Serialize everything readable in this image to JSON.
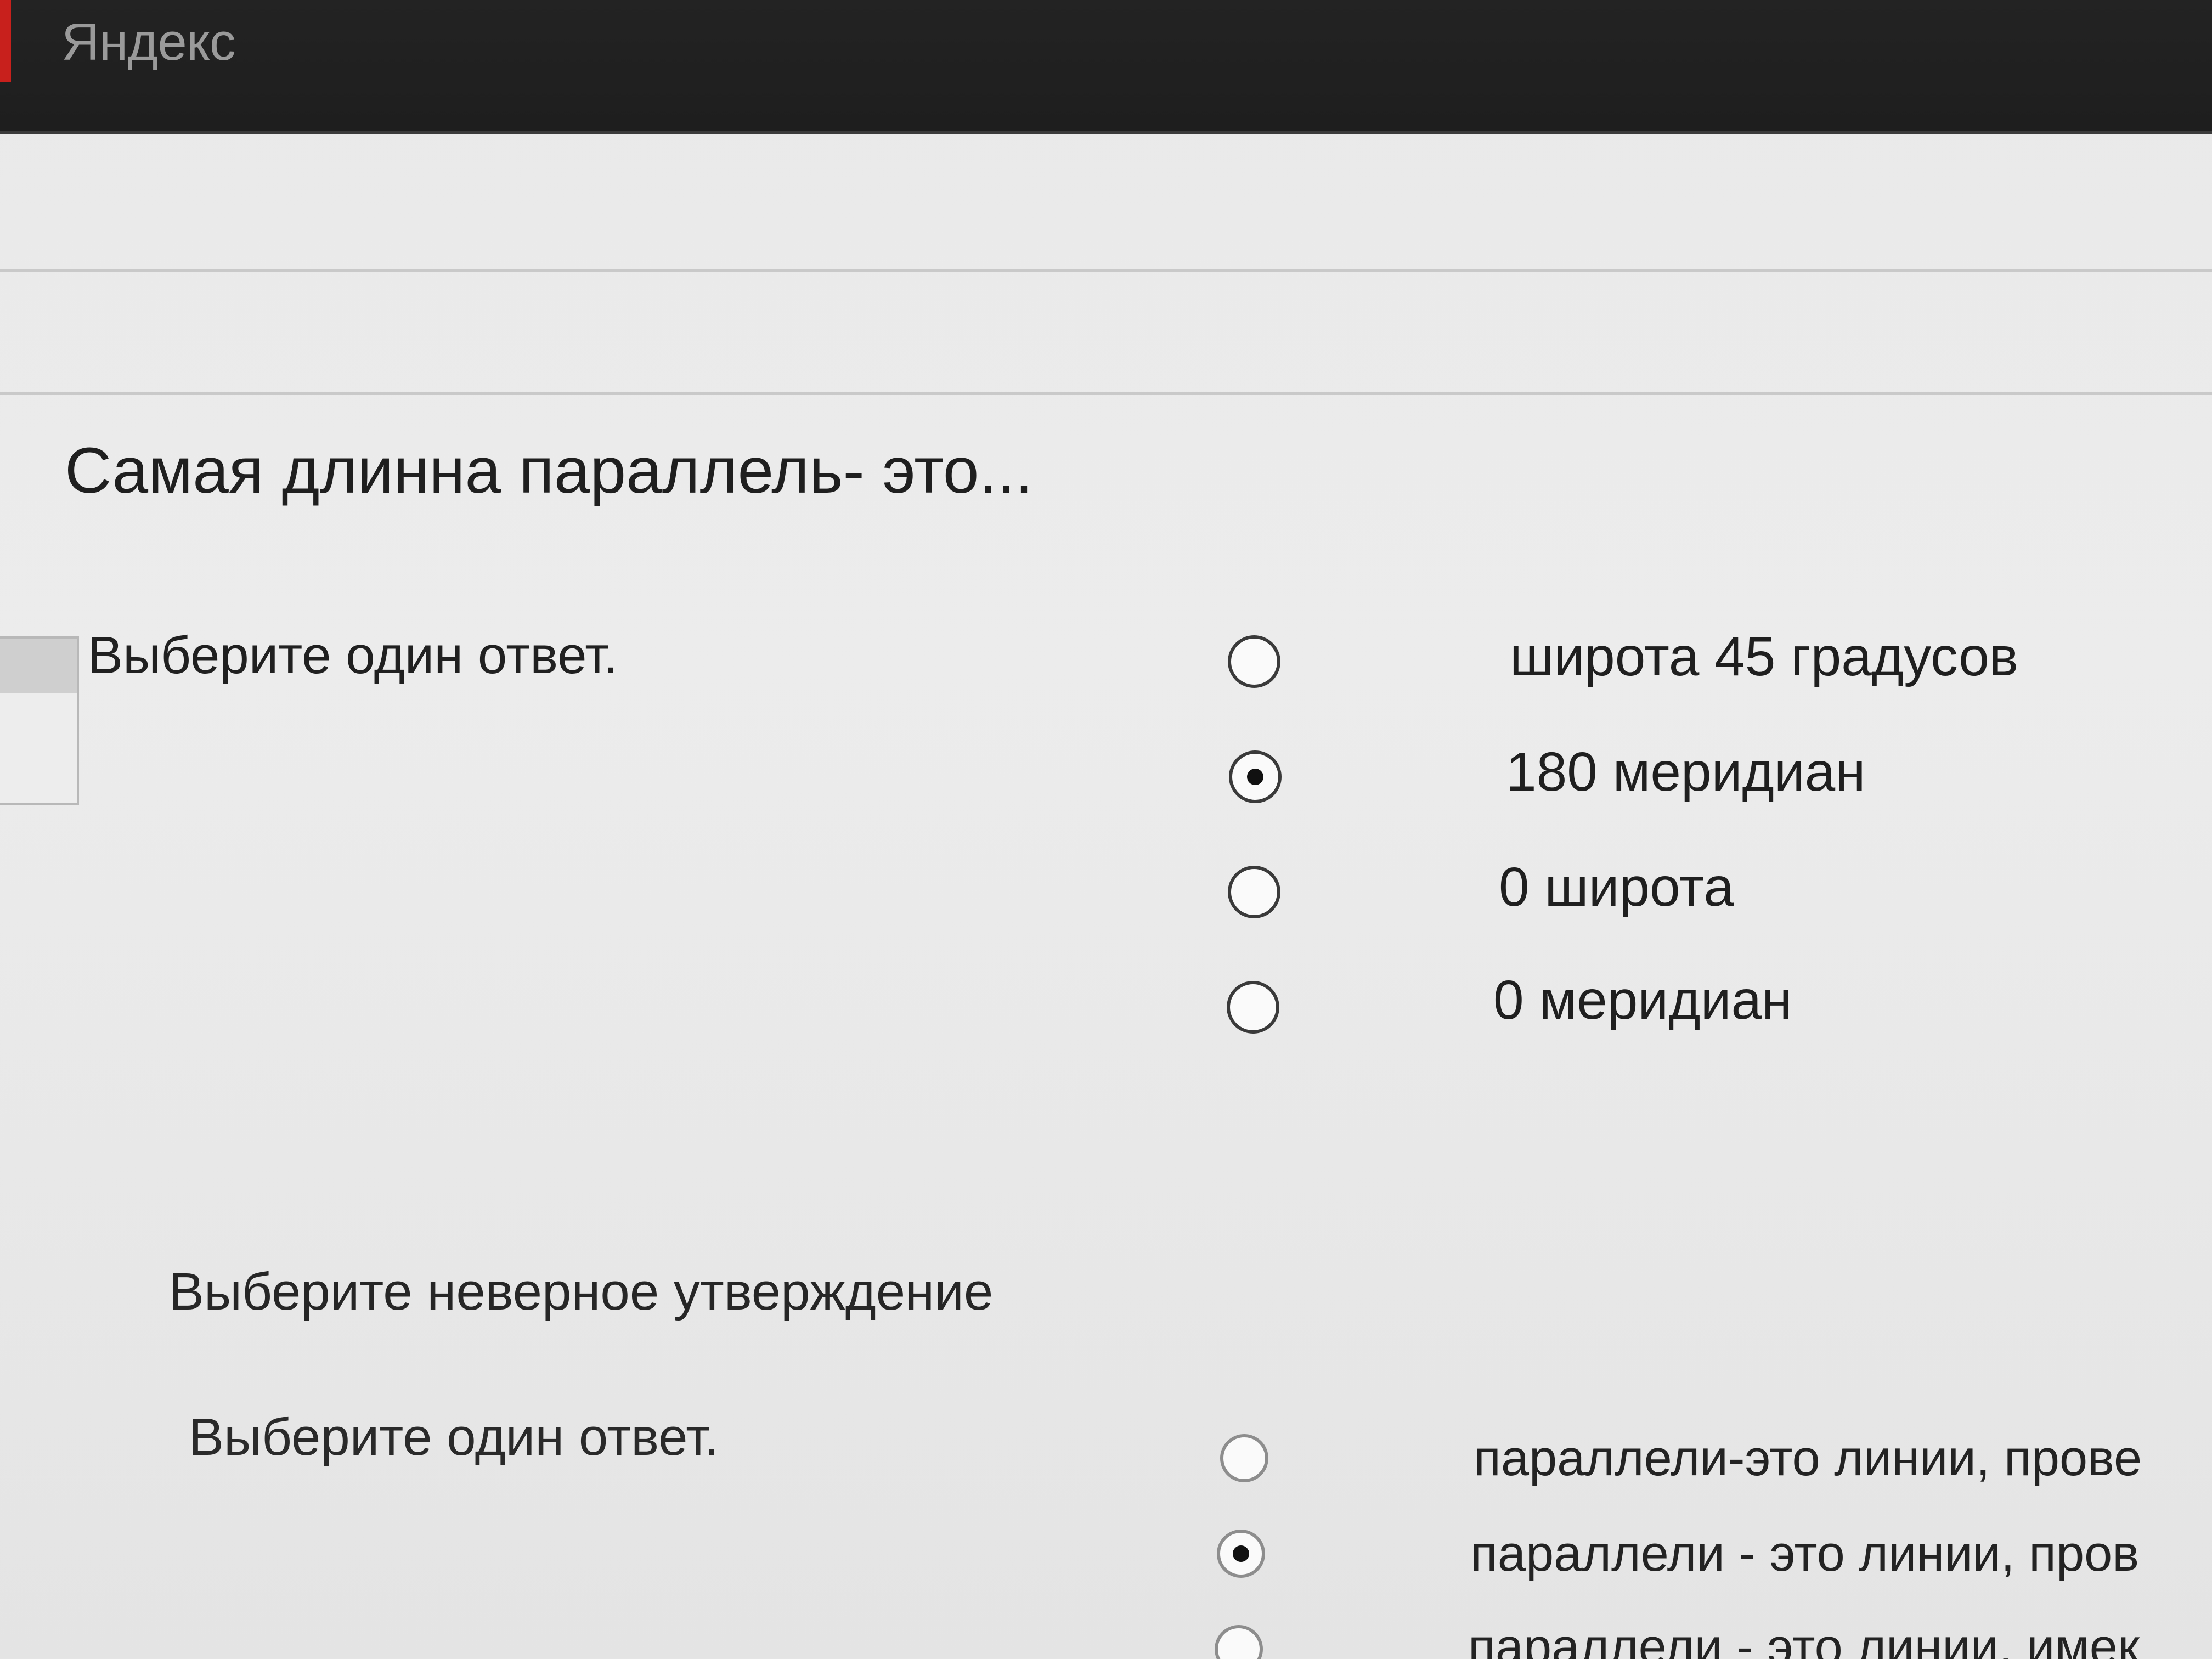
{
  "header": {
    "brand": "Яндекс",
    "accent_color": "#c8201c"
  },
  "question1": {
    "title": "Самая длинна параллель- это...",
    "prompt": "Выберите один ответ.",
    "options": [
      {
        "label": "широта 45 градусов",
        "checked": false
      },
      {
        "label": "180 меридиан",
        "checked": true
      },
      {
        "label": "0 широта",
        "checked": false
      },
      {
        "label": "0 меридиан",
        "checked": false
      }
    ]
  },
  "question2": {
    "title": "Выберите неверное утверждение",
    "prompt": "Выберите один ответ.",
    "options": [
      {
        "label": "параллели-это линии, прове",
        "checked": false
      },
      {
        "label": "параллели - это линии, пров",
        "checked": true
      },
      {
        "label": "параллели - это линии, имек",
        "checked": false
      }
    ]
  }
}
